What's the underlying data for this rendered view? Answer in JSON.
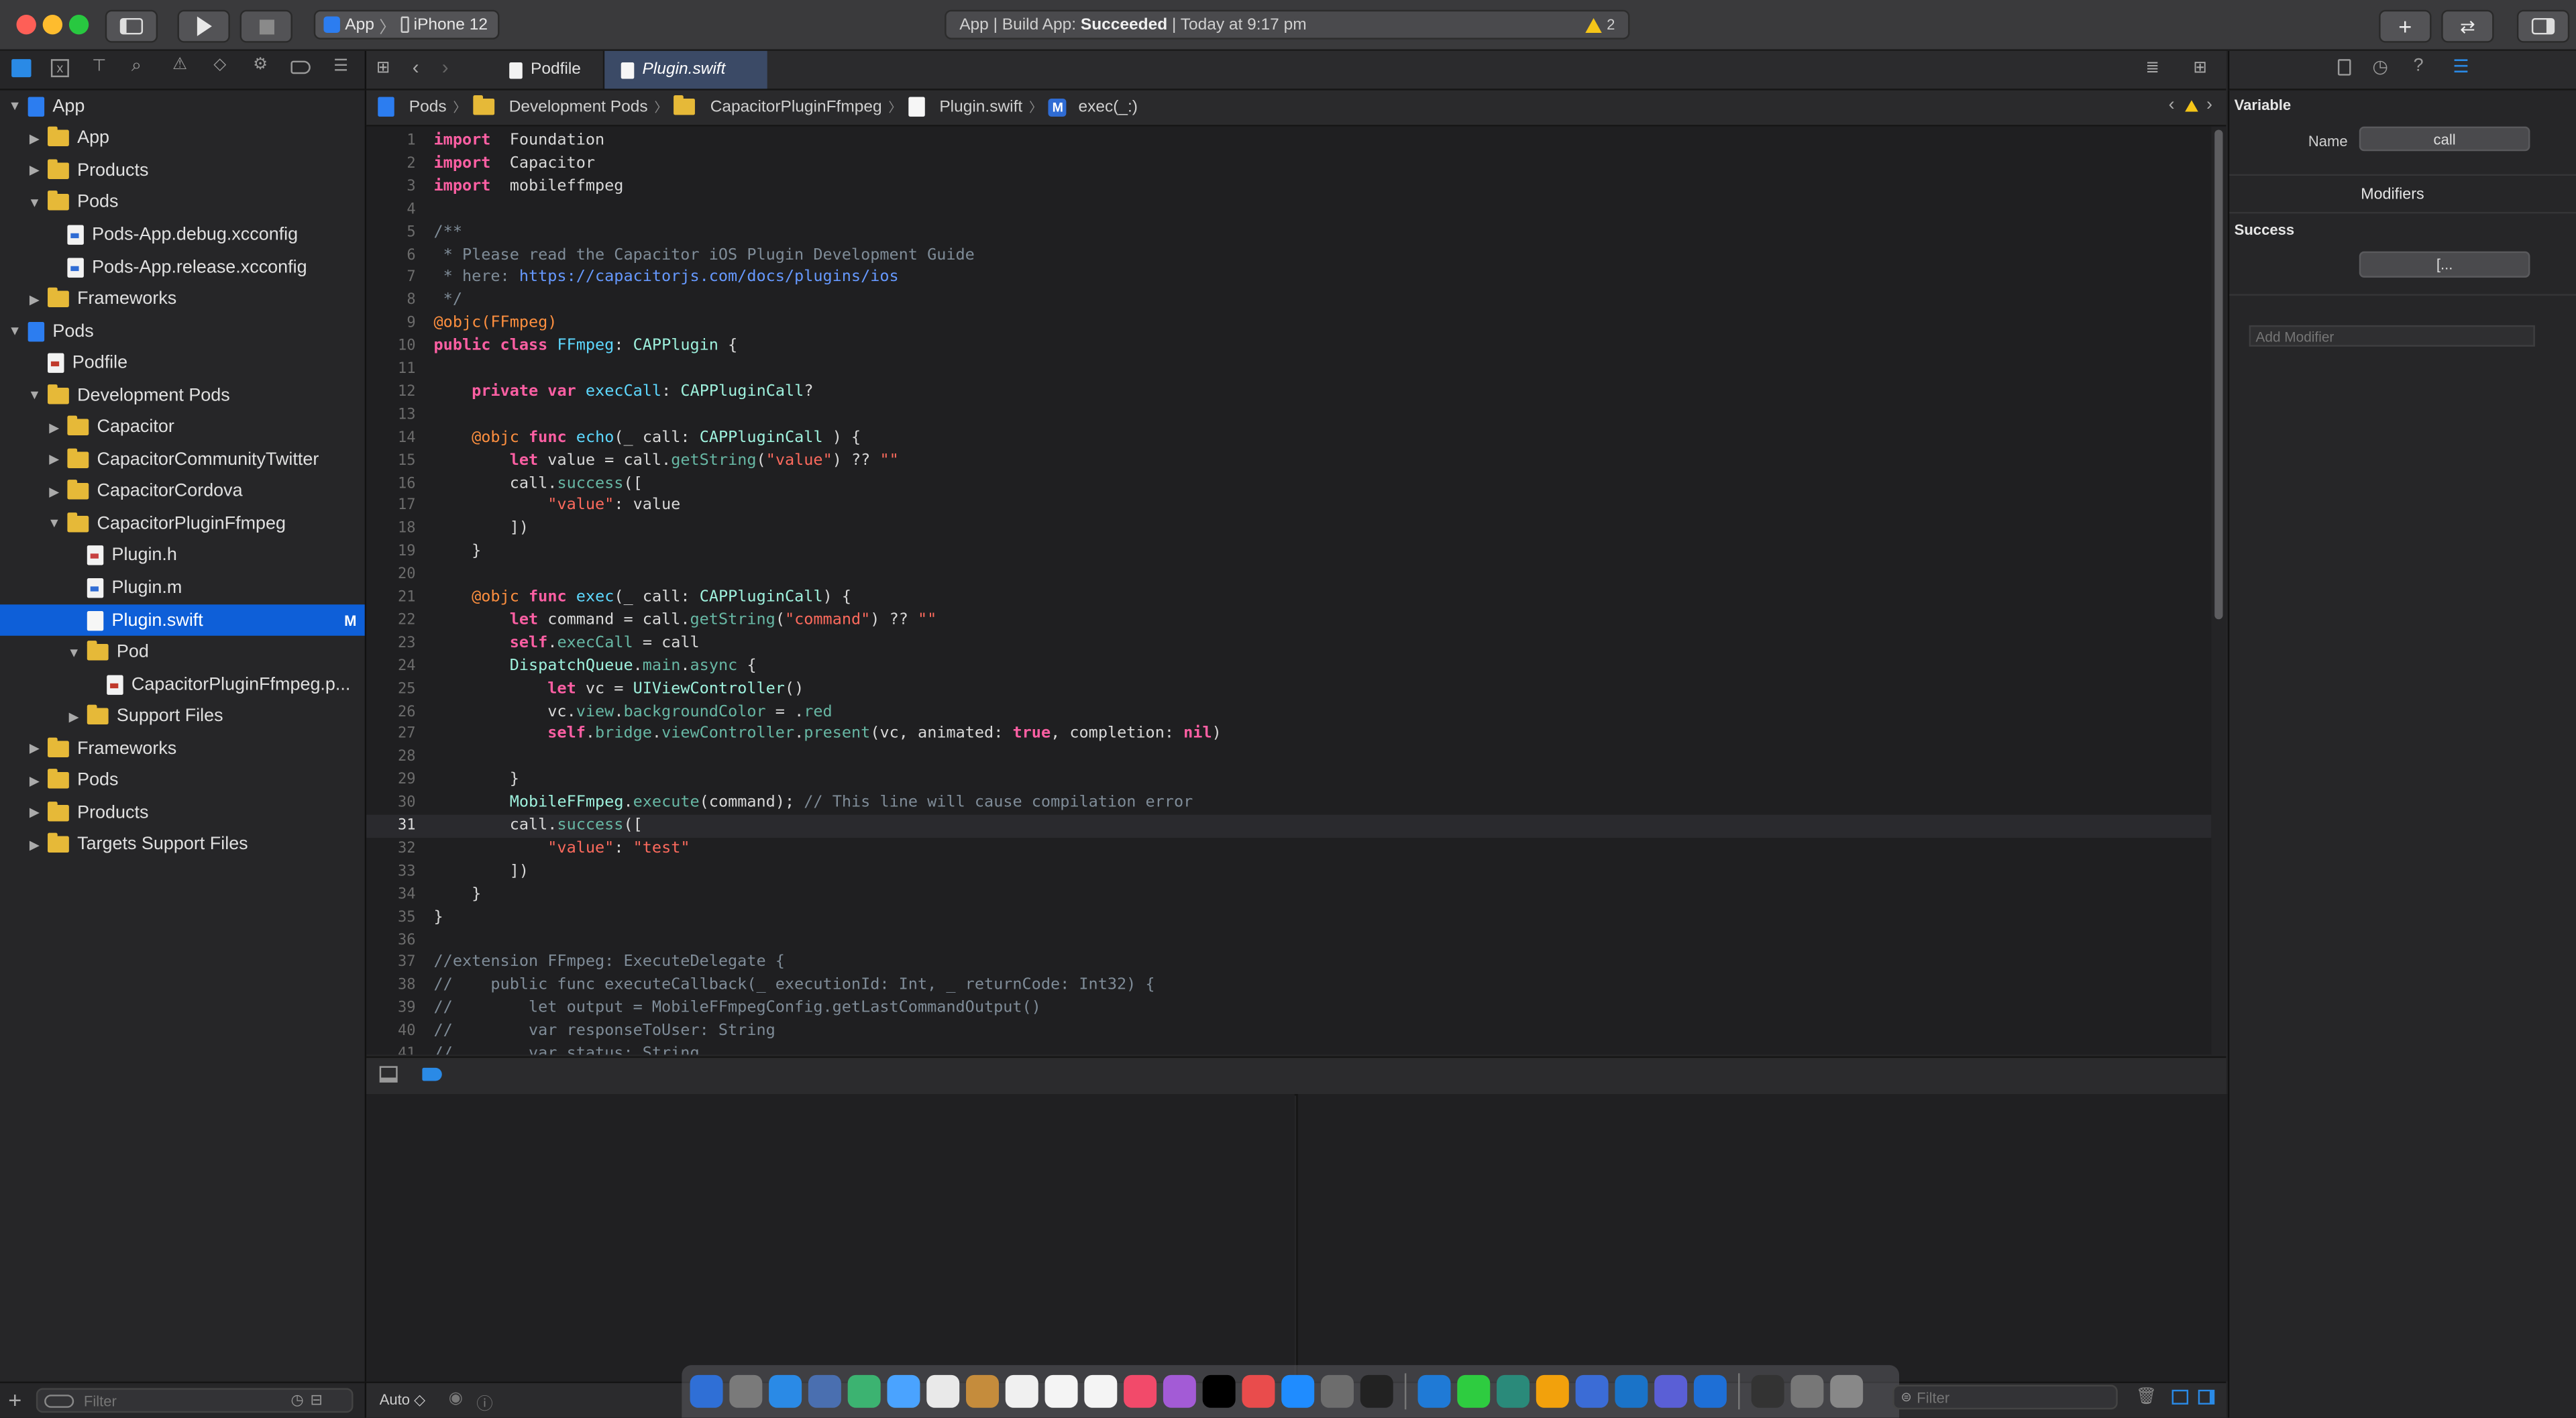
{
  "toolbar": {
    "scheme_target": "App",
    "scheme_device": "iPhone 12",
    "status_prefix": "App | Build App: ",
    "status_result": "Succeeded",
    "status_time": " | Today at 9:17 pm",
    "warning_count": "2"
  },
  "navigator": {
    "items": [
      {
        "label": "App",
        "depth": 0,
        "kind": "proj",
        "open": true,
        "tri": true
      },
      {
        "label": "App",
        "depth": 1,
        "kind": "folder",
        "open": false,
        "tri": true
      },
      {
        "label": "Products",
        "depth": 1,
        "kind": "folder",
        "open": false,
        "tri": true
      },
      {
        "label": "Pods",
        "depth": 1,
        "kind": "folder",
        "open": true,
        "tri": true
      },
      {
        "label": "Pods-App.debug.xcconfig",
        "depth": 2,
        "kind": "xc",
        "tri": false
      },
      {
        "label": "Pods-App.release.xcconfig",
        "depth": 2,
        "kind": "xc",
        "tri": false
      },
      {
        "label": "Frameworks",
        "depth": 1,
        "kind": "folder",
        "open": false,
        "tri": true
      },
      {
        "label": "Pods",
        "depth": 0,
        "kind": "proj",
        "open": true,
        "tri": true
      },
      {
        "label": "Podfile",
        "depth": 1,
        "kind": "pd",
        "tri": false
      },
      {
        "label": "Development Pods",
        "depth": 1,
        "kind": "folder",
        "open": true,
        "tri": true
      },
      {
        "label": "Capacitor",
        "depth": 2,
        "kind": "folder",
        "open": false,
        "tri": true
      },
      {
        "label": "CapacitorCommunityTwitter",
        "depth": 2,
        "kind": "folder",
        "open": false,
        "tri": true
      },
      {
        "label": "CapacitorCordova",
        "depth": 2,
        "kind": "folder",
        "open": false,
        "tri": true
      },
      {
        "label": "CapacitorPluginFfmpeg",
        "depth": 2,
        "kind": "folder",
        "open": true,
        "tri": true
      },
      {
        "label": "Plugin.h",
        "depth": 3,
        "kind": "h",
        "tri": false
      },
      {
        "label": "Plugin.m",
        "depth": 3,
        "kind": "m",
        "tri": false
      },
      {
        "label": "Plugin.swift",
        "depth": 3,
        "kind": "swift",
        "tri": false,
        "selected": true,
        "badge": "M"
      },
      {
        "label": "Pod",
        "depth": 3,
        "kind": "folder",
        "open": true,
        "tri": true
      },
      {
        "label": "CapacitorPluginFfmpeg.p...",
        "depth": 4,
        "kind": "pd",
        "tri": false
      },
      {
        "label": "Support Files",
        "depth": 3,
        "kind": "folder",
        "open": false,
        "tri": true
      },
      {
        "label": "Frameworks",
        "depth": 1,
        "kind": "folder",
        "open": false,
        "tri": true
      },
      {
        "label": "Pods",
        "depth": 1,
        "kind": "folder",
        "open": false,
        "tri": true
      },
      {
        "label": "Products",
        "depth": 1,
        "kind": "folder",
        "open": false,
        "tri": true
      },
      {
        "label": "Targets Support Files",
        "depth": 1,
        "kind": "folder",
        "open": false,
        "tri": true
      }
    ],
    "filter_placeholder": "Filter"
  },
  "tabs": [
    {
      "label": "Podfile",
      "active": false
    },
    {
      "label": "Plugin.swift",
      "active": true
    }
  ],
  "jumpbar": [
    "Pods",
    "Development Pods",
    "CapacitorPluginFfmpeg",
    "Plugin.swift",
    "exec(_:)"
  ],
  "jumpbar_method_badge": "M",
  "editor": {
    "current_line": 31,
    "lines": [
      [
        [
          "kw",
          "import"
        ],
        [
          "",
          "  Foundation"
        ]
      ],
      [
        [
          "kw",
          "import"
        ],
        [
          "",
          "  Capacitor"
        ]
      ],
      [
        [
          "kw",
          "import"
        ],
        [
          "",
          "  mobileffmpeg"
        ]
      ],
      [],
      [
        [
          "cm",
          "/**"
        ]
      ],
      [
        [
          "cm",
          " * Please read the Capacitor iOS Plugin Development Guide"
        ]
      ],
      [
        [
          "cm",
          " * here: "
        ],
        [
          "url",
          "https://capacitorjs.com/docs/plugins/ios"
        ]
      ],
      [
        [
          "cm",
          " */"
        ]
      ],
      [
        [
          "at",
          "@objc(FFmpeg)"
        ]
      ],
      [
        [
          "kw",
          "public class"
        ],
        [
          "",
          " "
        ],
        [
          "ty",
          "FFmpeg"
        ],
        [
          "",
          ": "
        ],
        [
          "tyb",
          "CAPPlugin"
        ],
        [
          "",
          " {"
        ]
      ],
      [],
      [
        [
          "",
          "    "
        ],
        [
          "kw",
          "private var"
        ],
        [
          "",
          " "
        ],
        [
          "ty",
          "execCall"
        ],
        [
          "",
          ": "
        ],
        [
          "tyb",
          "CAPPluginCall"
        ],
        [
          "",
          "?"
        ]
      ],
      [],
      [
        [
          "",
          "    "
        ],
        [
          "at",
          "@objc"
        ],
        [
          "",
          " "
        ],
        [
          "kw",
          "func"
        ],
        [
          "",
          " "
        ],
        [
          "ty",
          "echo"
        ],
        [
          "",
          "(_ call: "
        ],
        [
          "tyb",
          "CAPPluginCall"
        ],
        [
          "",
          " ) {"
        ]
      ],
      [
        [
          "",
          "        "
        ],
        [
          "kw",
          "let"
        ],
        [
          "",
          " value = call."
        ],
        [
          "fn",
          "getString"
        ],
        [
          "",
          "("
        ],
        [
          "st",
          "\"value\""
        ],
        [
          "",
          ") ?? "
        ],
        [
          "st",
          "\"\""
        ]
      ],
      [
        [
          "",
          "        call."
        ],
        [
          "fn",
          "success"
        ],
        [
          "",
          "(["
        ]
      ],
      [
        [
          "",
          "            "
        ],
        [
          "st",
          "\"value\""
        ],
        [
          "",
          ": value"
        ]
      ],
      [
        [
          "",
          "        ])"
        ]
      ],
      [
        [
          "",
          "    }"
        ]
      ],
      [],
      [
        [
          "",
          "    "
        ],
        [
          "at",
          "@objc"
        ],
        [
          "",
          " "
        ],
        [
          "kw",
          "func"
        ],
        [
          "",
          " "
        ],
        [
          "ty",
          "exec"
        ],
        [
          "",
          "(_ call: "
        ],
        [
          "tyb",
          "CAPPluginCall"
        ],
        [
          "",
          ") {"
        ]
      ],
      [
        [
          "",
          "        "
        ],
        [
          "kw",
          "let"
        ],
        [
          "",
          " command = call."
        ],
        [
          "fn",
          "getString"
        ],
        [
          "",
          "("
        ],
        [
          "st",
          "\"command\""
        ],
        [
          "",
          ") ?? "
        ],
        [
          "st",
          "\"\""
        ]
      ],
      [
        [
          "",
          "        "
        ],
        [
          "kw",
          "self"
        ],
        [
          "",
          "."
        ],
        [
          "fn",
          "execCall"
        ],
        [
          "",
          " = call"
        ]
      ],
      [
        [
          "",
          "        "
        ],
        [
          "tyb",
          "DispatchQueue"
        ],
        [
          "",
          "."
        ],
        [
          "fn",
          "main"
        ],
        [
          "",
          "."
        ],
        [
          "fn",
          "async"
        ],
        [
          "",
          " {"
        ]
      ],
      [
        [
          "",
          "            "
        ],
        [
          "kw",
          "let"
        ],
        [
          "",
          " vc = "
        ],
        [
          "tyb",
          "UIViewController"
        ],
        [
          "",
          "()"
        ]
      ],
      [
        [
          "",
          "            vc."
        ],
        [
          "fn",
          "view"
        ],
        [
          "",
          "."
        ],
        [
          "fn",
          "backgroundColor"
        ],
        [
          "",
          " = ."
        ],
        [
          "fn",
          "red"
        ]
      ],
      [
        [
          "",
          "            "
        ],
        [
          "kw",
          "self"
        ],
        [
          "",
          "."
        ],
        [
          "fn",
          "bridge"
        ],
        [
          "",
          "."
        ],
        [
          "fn",
          "viewController"
        ],
        [
          "",
          "."
        ],
        [
          "fn",
          "present"
        ],
        [
          "",
          "(vc, animated: "
        ],
        [
          "kw",
          "true"
        ],
        [
          "",
          ", completion: "
        ],
        [
          "kw",
          "nil"
        ],
        [
          "",
          ")"
        ]
      ],
      [],
      [
        [
          "",
          "        }"
        ]
      ],
      [
        [
          "",
          "        "
        ],
        [
          "tyb",
          "MobileFFmpeg"
        ],
        [
          "",
          "."
        ],
        [
          "fn",
          "execute"
        ],
        [
          "",
          "(command); "
        ],
        [
          "cm",
          "// This line will cause compilation error"
        ]
      ],
      [
        [
          "",
          "        call."
        ],
        [
          "fn",
          "success"
        ],
        [
          "",
          "(["
        ]
      ],
      [
        [
          "",
          "            "
        ],
        [
          "st",
          "\"value\""
        ],
        [
          "",
          ": "
        ],
        [
          "st",
          "\"test\""
        ]
      ],
      [
        [
          "",
          "        ])"
        ]
      ],
      [
        [
          "",
          "    }"
        ]
      ],
      [
        [
          "",
          "}"
        ]
      ],
      [],
      [
        [
          "cm",
          "//extension FFmpeg: ExecuteDelegate {"
        ]
      ],
      [
        [
          "cm",
          "//    public func executeCallback(_ executionId: Int, _ returnCode: Int32) {"
        ]
      ],
      [
        [
          "cm",
          "//        let output = MobileFFmpegConfig.getLastCommandOutput()"
        ]
      ],
      [
        [
          "cm",
          "//        var responseToUser: String"
        ]
      ],
      [
        [
          "cm",
          "//        var status: String"
        ]
      ]
    ]
  },
  "bottom": {
    "auto_label": "Auto ◇"
  },
  "inspector": {
    "variable_title": "Variable",
    "name_label": "Name",
    "name_value": "call",
    "modifiers_title": "Modifiers",
    "success_title": "Success",
    "success_value": "[...",
    "add_modifier_placeholder": "Add Modifier"
  },
  "dock": {
    "filter_placeholder": "Filter",
    "colors": [
      "#2f6fd6",
      "#7a7a7a",
      "#2a8ae6",
      "#4a6fb0",
      "#3cb371",
      "#4aa3ff",
      "#e9e9e9",
      "#c58c3c",
      "#f0f0f0",
      "#f4f4f4",
      "#f4f4f4",
      "#f24a6a",
      "#a35bd6",
      "#000000",
      "#e94c4c",
      "#1f8cff",
      "#6d6d6d",
      "#222222",
      "#1f7ad6",
      "#2ecc40",
      "#2a8a7a",
      "#f2a10c",
      "#3b6cd6",
      "#1a73c8",
      "#5a5fd6",
      "#1e6fd6",
      "#333333",
      "#777777",
      "#888888"
    ]
  }
}
